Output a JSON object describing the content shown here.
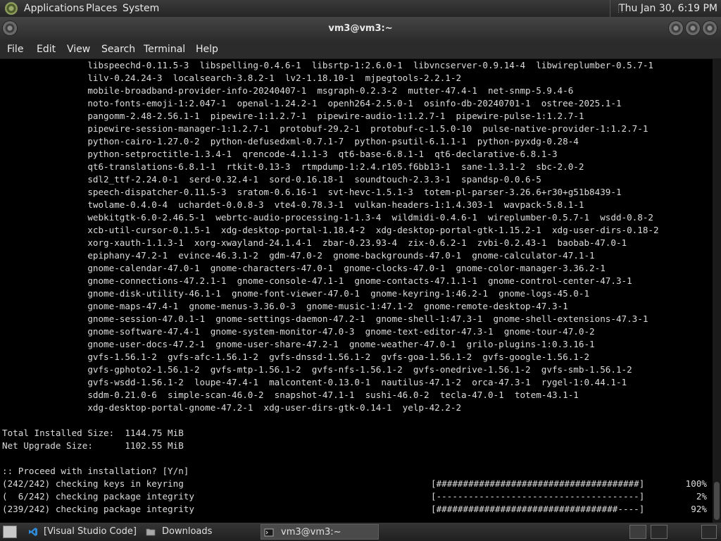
{
  "top_panel": {
    "menus": [
      "Applications",
      "Places",
      "System"
    ],
    "clock": "Thu Jan 30,  6:19 PM"
  },
  "window": {
    "title": "vm3@vm3:~"
  },
  "menubar": [
    "File",
    "Edit",
    "View",
    "Search",
    "Terminal",
    "Help"
  ],
  "terminal": {
    "lines": [
      "                libspeechd-0.11.5-3  libspelling-0.4.6-1  libsrtp-1:2.6.0-1  libvncserver-0.9.14-4  libwireplumber-0.5.7-1",
      "                lilv-0.24.24-3  localsearch-3.8.2-1  lv2-1.18.10-1  mjpegtools-2.2.1-2",
      "                mobile-broadband-provider-info-20240407-1  msgraph-0.2.3-2  mutter-47.4-1  net-snmp-5.9.4-6",
      "                noto-fonts-emoji-1:2.047-1  openal-1.24.2-1  openh264-2.5.0-1  osinfo-db-20240701-1  ostree-2025.1-1",
      "                pangomm-2.48-2.56.1-1  pipewire-1:1.2.7-1  pipewire-audio-1:1.2.7-1  pipewire-pulse-1:1.2.7-1",
      "                pipewire-session-manager-1:1.2.7-1  protobuf-29.2-1  protobuf-c-1.5.0-10  pulse-native-provider-1:1.2.7-1",
      "                python-cairo-1.27.0-2  python-defusedxml-0.7.1-7  python-psutil-6.1.1-1  python-pyxdg-0.28-4",
      "                python-setproctitle-1.3.4-1  qrencode-4.1.1-3  qt6-base-6.8.1-1  qt6-declarative-6.8.1-3",
      "                qt6-translations-6.8.1-1  rtkit-0.13-3  rtmpdump-1:2.4.r105.f6bb13-1  sane-1.3.1-2  sbc-2.0-2",
      "                sdl2_ttf-2.24.0-1  serd-0.32.4-1  sord-0.16.18-1  soundtouch-2.3.3-1  spandsp-0.0.6-5",
      "                speech-dispatcher-0.11.5-3  sratom-0.6.16-1  svt-hevc-1.5.1-3  totem-pl-parser-3.26.6+r30+g51b8439-1",
      "                twolame-0.4.0-4  uchardet-0.0.8-3  vte4-0.78.3-1  vulkan-headers-1:1.4.303-1  wavpack-5.8.1-1",
      "                webkitgtk-6.0-2.46.5-1  webrtc-audio-processing-1-1.3-4  wildmidi-0.4.6-1  wireplumber-0.5.7-1  wsdd-0.8-2",
      "                xcb-util-cursor-0.1.5-1  xdg-desktop-portal-1.18.4-2  xdg-desktop-portal-gtk-1.15.2-1  xdg-user-dirs-0.18-2",
      "                xorg-xauth-1.1.3-1  xorg-xwayland-24.1.4-1  zbar-0.23.93-4  zix-0.6.2-1  zvbi-0.2.43-1  baobab-47.0-1",
      "                epiphany-47.2-1  evince-46.3.1-2  gdm-47.0-2  gnome-backgrounds-47.0-1  gnome-calculator-47.1-1",
      "                gnome-calendar-47.0-1  gnome-characters-47.0-1  gnome-clocks-47.0-1  gnome-color-manager-3.36.2-1",
      "                gnome-connections-47.2.1-1  gnome-console-47.1-1  gnome-contacts-47.1.1-1  gnome-control-center-47.3-1",
      "                gnome-disk-utility-46.1-1  gnome-font-viewer-47.0-1  gnome-keyring-1:46.2-1  gnome-logs-45.0-1",
      "                gnome-maps-47.4-1  gnome-menus-3.36.0-3  gnome-music-1:47.1-2  gnome-remote-desktop-47.3-1",
      "                gnome-session-47.0.1-1  gnome-settings-daemon-47.2-1  gnome-shell-1:47.3-1  gnome-shell-extensions-47.3-1",
      "                gnome-software-47.4-1  gnome-system-monitor-47.0-3  gnome-text-editor-47.3-1  gnome-tour-47.0-2",
      "                gnome-user-docs-47.2-1  gnome-user-share-47.2-1  gnome-weather-47.0-1  grilo-plugins-1:0.3.16-1",
      "                gvfs-1.56.1-2  gvfs-afc-1.56.1-2  gvfs-dnssd-1.56.1-2  gvfs-goa-1.56.1-2  gvfs-google-1.56.1-2",
      "                gvfs-gphoto2-1.56.1-2  gvfs-mtp-1.56.1-2  gvfs-nfs-1.56.1-2  gvfs-onedrive-1.56.1-2  gvfs-smb-1.56.1-2",
      "                gvfs-wsdd-1.56.1-2  loupe-47.4-1  malcontent-0.13.0-1  nautilus-47.1-2  orca-47.3-1  rygel-1:0.44.1-1",
      "                sddm-0.21.0-6  simple-scan-46.0-2  snapshot-47.1-1  sushi-46.0-2  tecla-47.0-1  totem-43.1-1",
      "                xdg-desktop-portal-gnome-47.2-1  xdg-user-dirs-gtk-0.14-1  yelp-42.2-2",
      "",
      "Total Installed Size:  1144.75 MiB",
      "Net Upgrade Size:      1102.55 MiB",
      "",
      ":: Proceed with installation? [Y/n]"
    ],
    "progress": [
      {
        "text": "(242/242) checking keys in keyring",
        "bar": "[######################################]",
        "percent": "100%",
        "fraction": 1.0
      },
      {
        "text": "(  6/242) checking package integrity",
        "bar": "[--------------------------------------]",
        "percent": "2%",
        "fraction": 0.02
      },
      {
        "text": "(239/242) checking package integrity",
        "bar": "[##################################----]",
        "percent": "92%",
        "fraction": 0.92
      }
    ]
  },
  "taskbar": {
    "tasks": [
      {
        "label": "[Visual Studio Code]"
      },
      {
        "label": "Downloads"
      },
      {
        "label": "vm3@vm3:~"
      }
    ]
  }
}
